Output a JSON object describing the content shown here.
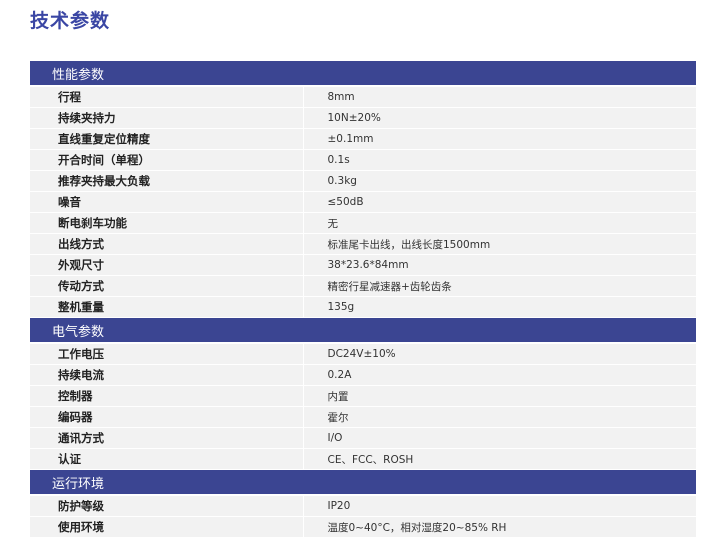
{
  "page": {
    "title": "技术参数"
  },
  "sections": [
    {
      "title": "性能参数",
      "rows": [
        {
          "label": "行程",
          "value": "8mm"
        },
        {
          "label": "持续夹持力",
          "value": "10N±20%"
        },
        {
          "label": "直线重复定位精度",
          "value": "±0.1mm"
        },
        {
          "label": "开合时间（单程）",
          "value": "0.1s"
        },
        {
          "label": "推荐夹持最大负载",
          "value": "0.3kg"
        },
        {
          "label": "噪音",
          "value": "≤50dB"
        },
        {
          "label": "断电刹车功能",
          "value": "无"
        },
        {
          "label": "出线方式",
          "value": "标准尾卡出线，出线长度1500mm"
        },
        {
          "label": "外观尺寸",
          "value": "38*23.6*84mm"
        },
        {
          "label": "传动方式",
          "value": "精密行星减速器+齿轮齿条"
        },
        {
          "label": "整机重量",
          "value": "135g"
        }
      ]
    },
    {
      "title": "电气参数",
      "rows": [
        {
          "label": "工作电压",
          "value": "DC24V±10%"
        },
        {
          "label": "持续电流",
          "value": "0.2A"
        },
        {
          "label": "控制器",
          "value": "内置"
        },
        {
          "label": "编码器",
          "value": "霍尔"
        },
        {
          "label": "通讯方式",
          "value": "I/O"
        },
        {
          "label": "认证",
          "value": "CE、FCC、ROSH"
        }
      ]
    },
    {
      "title": "运行环境",
      "rows": [
        {
          "label": "防护等级",
          "value": "IP20"
        },
        {
          "label": "使用环境",
          "value": "温度0~40°C，相对湿度20~85% RH"
        }
      ]
    }
  ]
}
